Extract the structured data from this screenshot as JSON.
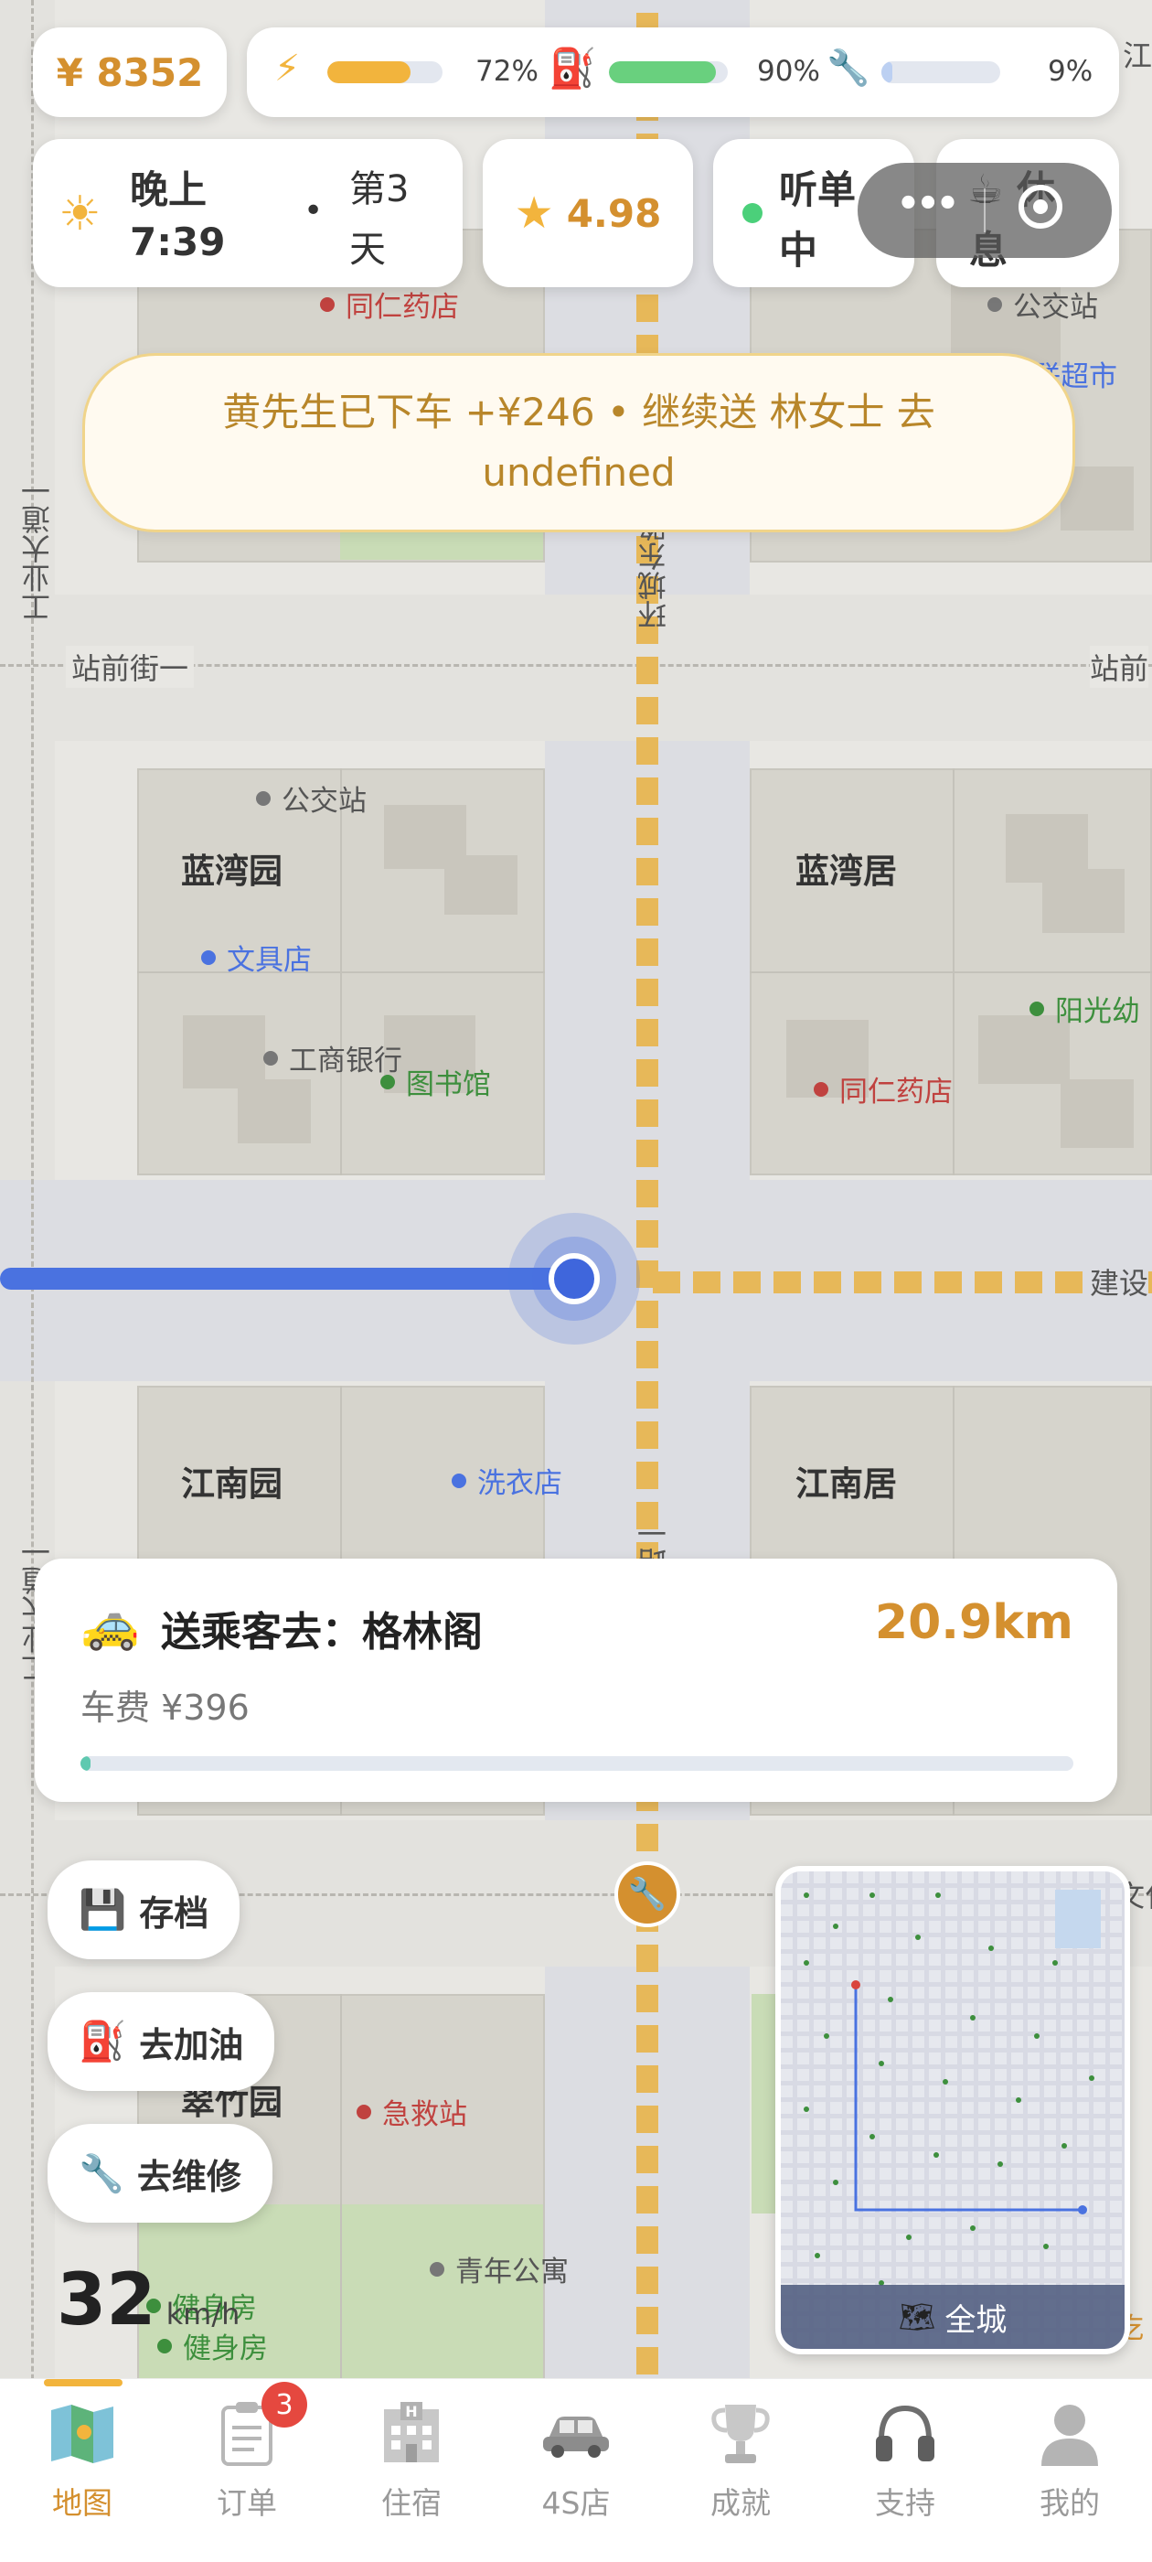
{
  "status_bar": {
    "money": "¥ 8352",
    "energy_percent": "72%",
    "energy_value": 0.72,
    "fuel_percent": "90%",
    "fuel_value": 0.9,
    "wear_percent": "9%",
    "wear_value": 0.09
  },
  "info_row": {
    "time_period": "晚上",
    "time": "7:39",
    "separator": "•",
    "day_prefix": "第3",
    "day_suffix": "天",
    "rating": "4.98",
    "status_line1": "听单",
    "status_line2": "中",
    "rest_line1": "休",
    "rest_line2": "息"
  },
  "toast": {
    "line1": "黄先生已下车 +¥246 • 继续送 林女士 去",
    "line2": "undefined"
  },
  "map": {
    "roads": {
      "vertical_left": "工业大道一",
      "vertical_left_lower": "工业大道一",
      "vertical_center": "环城东路",
      "vertical_center_lower": "环城东路一",
      "horizontal_top_left": "站前街一",
      "horizontal_top_right": "站前",
      "horizontal_mid_right": "建设",
      "horizontal_lower_right": "文化",
      "top_right_road": "江"
    },
    "blocks": {
      "lanwan_yuan": "蓝湾园",
      "lanwan_ju": "蓝湾居",
      "jiangnan_yuan": "江南园",
      "jiangnan_ju": "江南居",
      "cuixing_yuan": "翠竹园"
    },
    "pois": {
      "tongren_top": "同仁药店",
      "bus_top_right": "公交站",
      "supermarket": "华联超市",
      "bus_mid": "公交站",
      "stationery": "文具店",
      "icbc": "工商银行",
      "library": "图书馆",
      "tongren_mid": "同仁药店",
      "kindergarten": "阳光幼",
      "laundry": "洗衣店",
      "emergency": "急救站",
      "youth_apartment": "青年公寓",
      "gym1": "健身房",
      "gym2": "健身房",
      "right_edge_lower": "吃"
    }
  },
  "trip": {
    "icon": "taxi-icon",
    "title": "送乘客去：格林阁",
    "distance": "20.9km",
    "fare": "车费 ¥396",
    "progress": 0.01
  },
  "actions": {
    "save": "存档",
    "refuel": "去加油",
    "repair": "去维修"
  },
  "speed": {
    "value": "32",
    "unit": "km/h"
  },
  "minimap": {
    "label": "全城"
  },
  "capsule": {
    "more": "•••",
    "close": "close-icon"
  },
  "tabbar": {
    "tabs": [
      {
        "label": "地图",
        "icon": "map-icon",
        "active": true
      },
      {
        "label": "订单",
        "icon": "clipboard-icon",
        "badge": "3"
      },
      {
        "label": "住宿",
        "icon": "hotel-icon"
      },
      {
        "label": "4S店",
        "icon": "car-icon"
      },
      {
        "label": "成就",
        "icon": "trophy-icon"
      },
      {
        "label": "支持",
        "icon": "headphones-icon"
      },
      {
        "label": "我的",
        "icon": "user-icon"
      }
    ]
  },
  "colors": {
    "accent": "#d4902f",
    "route": "#4a72e0",
    "energy": "#f2b43d",
    "fuel": "#69d07e",
    "wear": "#bcd0f2"
  }
}
